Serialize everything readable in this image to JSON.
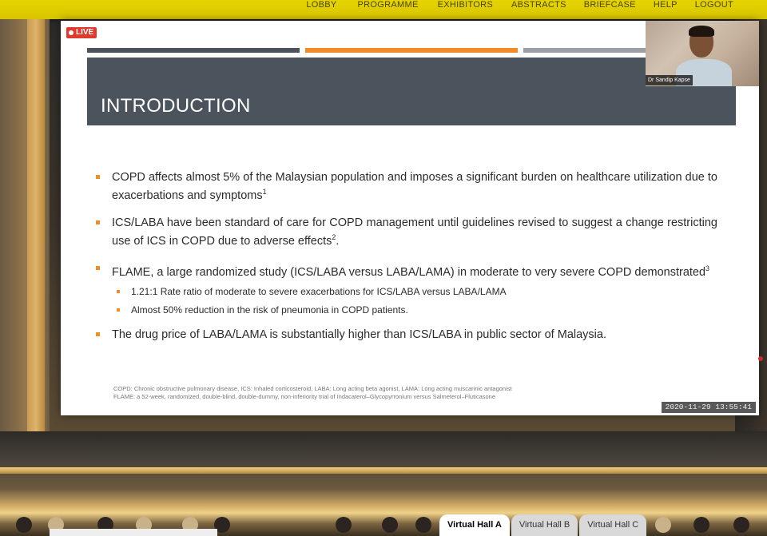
{
  "nav": {
    "items": [
      "LOBBY",
      "PROGRAMME",
      "EXHIBITORS",
      "ABSTRACTS",
      "BRIEFCASE",
      "HELP",
      "LOGOUT"
    ]
  },
  "stream": {
    "live_label": "LIVE",
    "timestamp": "2020-11-29  13:55:41",
    "speaker_name": "Dr Sandip Kapse"
  },
  "slide": {
    "title": "INTRODUCTION",
    "accent_bar_colors": [
      "#4b545c",
      "#f28c28",
      "#9aa0a6"
    ],
    "bullets": [
      {
        "text": "COPD affects almost 5% of the Malaysian population and imposes a significant burden on healthcare utilization due to exacerbations and symptoms",
        "sup": "1"
      },
      {
        "text": "ICS/LABA have been standard of care for COPD management until guidelines revised to suggest a change restricting use of ICS in COPD due to adverse effects",
        "sup": "2",
        "tail": "."
      },
      {
        "text": "FLAME, a large randomized study (ICS/LABA versus LABA/LAMA) in moderate to very severe COPD demonstrated",
        "sup": "3"
      },
      {
        "text": "The drug price of LABA/LAMA is substantially higher than ICS/LABA in public sector of Malaysia."
      }
    ],
    "sub_bullets": [
      "1.21:1 Rate ratio of moderate to severe exacerbations for ICS/LABA versus LABA/LAMA",
      "Almost 50% reduction in the risk of pneumonia in COPD patients."
    ],
    "footnotes": [
      "COPD: Chronic obstructive pulmonary disease, ICS: Inhaled corticosteroid, LABA: Long acting beta agonist, LAMA: Long acting muscarinic antagonist",
      "FLAME: a 52-week, randomized, double-blind, double-dummy, non-inferiority trial of Indacaterol–Glycopyrronium versus Salmeterol–Fluticasone"
    ]
  },
  "halls": {
    "tabs": [
      "Virtual Hall A",
      "Virtual Hall B",
      "Virtual Hall C"
    ],
    "active": "Virtual Hall A"
  }
}
